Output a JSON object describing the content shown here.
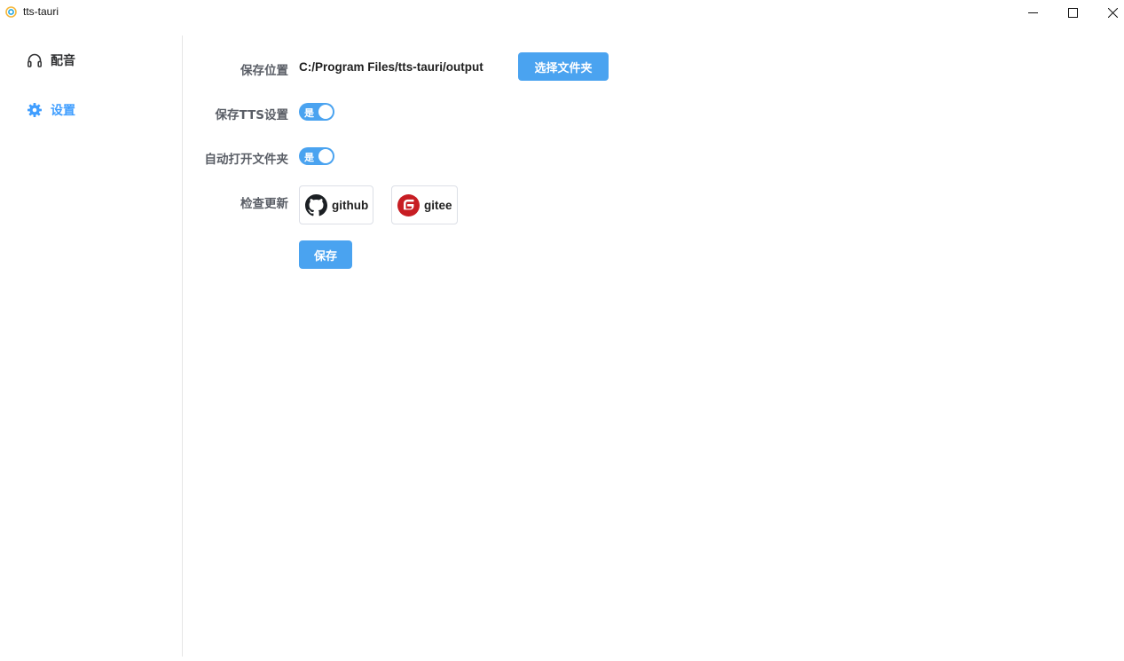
{
  "window": {
    "title": "tts-tauri"
  },
  "sidebar": {
    "items": [
      {
        "label": "配音",
        "icon": "headphones-icon"
      },
      {
        "label": "设置",
        "icon": "gear-icon",
        "active": true
      }
    ]
  },
  "settings": {
    "save_location_label": "保存位置",
    "save_location_value": "C:/Program Files/tts-tauri/output",
    "choose_folder_button": "选择文件夹",
    "save_tts_label": "保存TTS设置",
    "save_tts_switch_text": "是",
    "save_tts_on": true,
    "auto_open_label": "自动打开文件夹",
    "auto_open_switch_text": "是",
    "auto_open_on": true,
    "check_update_label": "检查更新",
    "github_label": "github",
    "gitee_label": "gitee",
    "save_button": "保存"
  },
  "colors": {
    "accent": "#409eff",
    "button": "#4aa3f0",
    "gitee_red": "#c71d23"
  }
}
